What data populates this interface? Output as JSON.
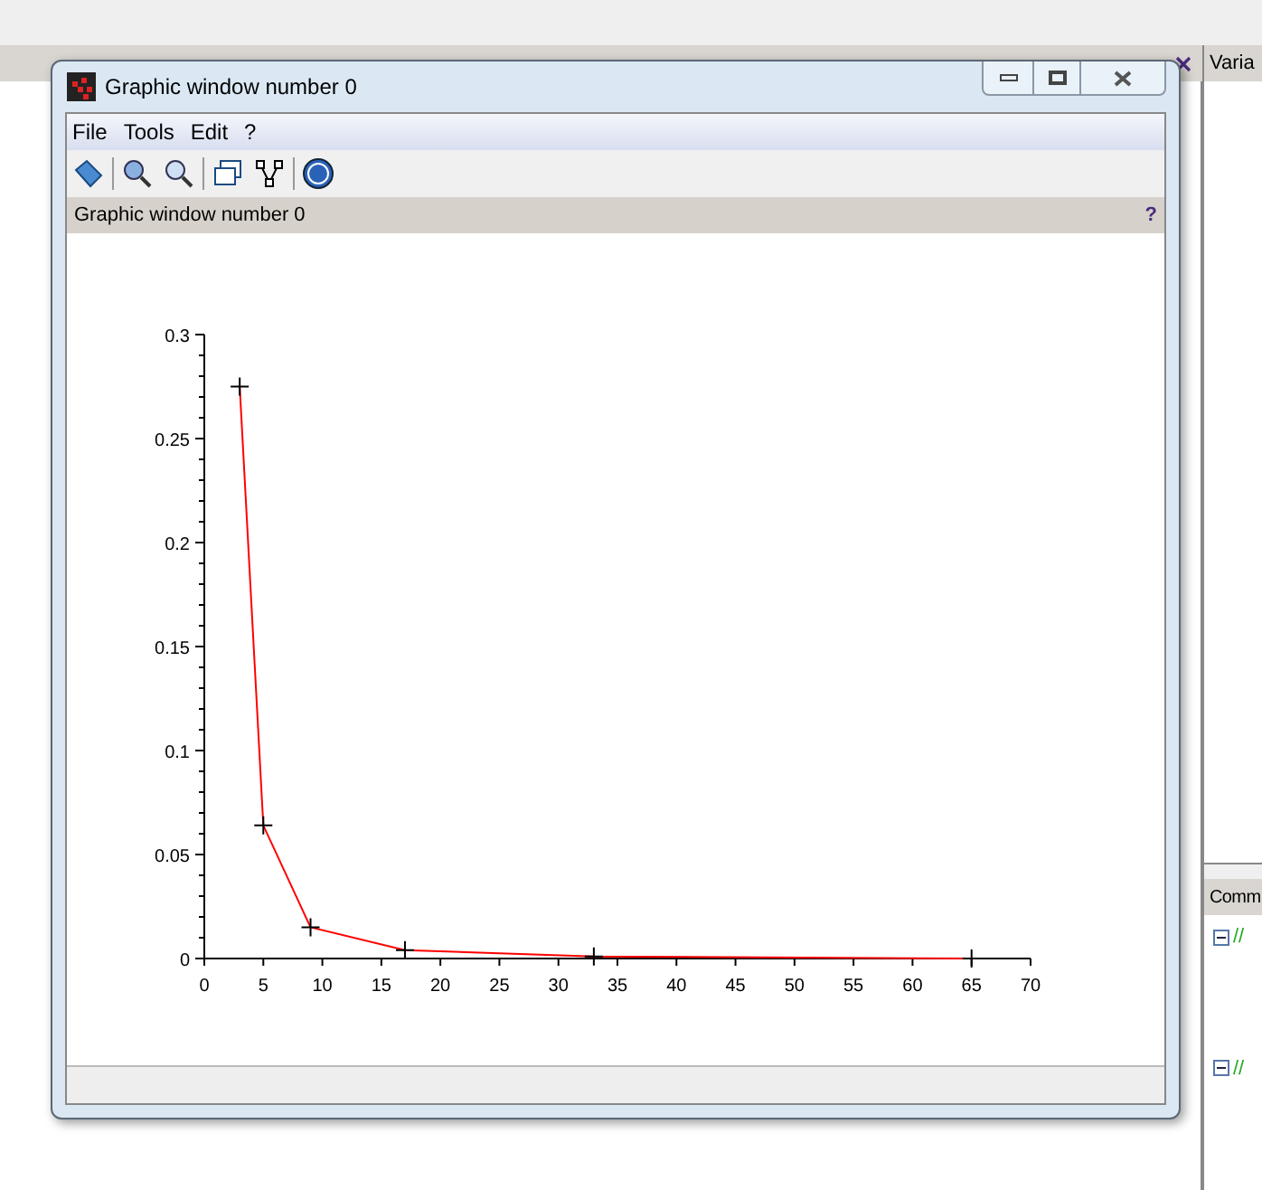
{
  "background": {
    "right_panel_title": "Varia",
    "bottom_panel_title": "Comm",
    "tree_items": [
      {
        "label": "//",
        "expanded": true
      },
      {
        "label": "//",
        "expanded": true
      }
    ]
  },
  "window": {
    "title": "Graphic window number 0",
    "menu": [
      "File",
      "Tools",
      "Edit",
      "?"
    ],
    "figure_title": "Graphic window number 0",
    "help_mark": "?",
    "chart_data": {
      "type": "line",
      "x": [
        3,
        5,
        9,
        17,
        33,
        65
      ],
      "series": [
        {
          "color": "#ff0000",
          "values": [
            0.275,
            0.064,
            0.015,
            0.004,
            0.001,
            0
          ]
        }
      ],
      "xlim": [
        0,
        70
      ],
      "ylim": [
        0,
        0.3
      ],
      "xticks": [
        0,
        5,
        10,
        15,
        20,
        25,
        30,
        35,
        40,
        45,
        50,
        55,
        60,
        65,
        70
      ],
      "yticks": [
        {
          "value": 0,
          "label": "0"
        },
        {
          "value": 0.05,
          "label": "0.05"
        },
        {
          "value": 0.1,
          "label": "0.1"
        },
        {
          "value": 0.15,
          "label": "0.15"
        },
        {
          "value": 0.2,
          "label": "0.2"
        },
        {
          "value": 0.25,
          "label": "0.25"
        },
        {
          "value": 0.3,
          "label": "0.3"
        }
      ]
    }
  }
}
